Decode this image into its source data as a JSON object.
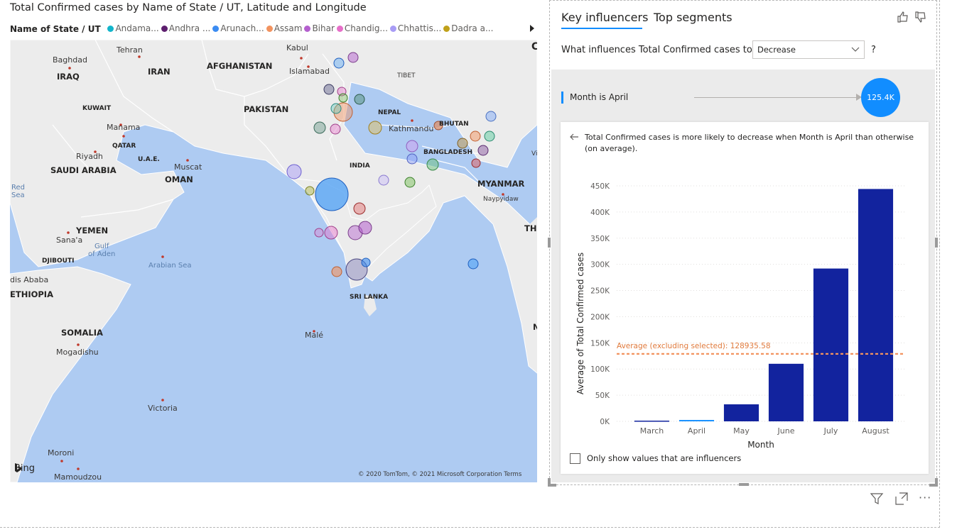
{
  "map_visual": {
    "title": "Total Confirmed cases by Name of State / UT, Latitude and Longitude",
    "legend": {
      "title": "Name of State / UT",
      "items": [
        {
          "label": "Andama...",
          "color": "#12b5cb"
        },
        {
          "label": "Andhra ...",
          "color": "#5d1e6e"
        },
        {
          "label": "Arunach...",
          "color": "#3b8cf2"
        },
        {
          "label": "Assam",
          "color": "#f2935f"
        },
        {
          "label": "Bihar",
          "color": "#b45fce"
        },
        {
          "label": "Chandig...",
          "color": "#e66fc8"
        },
        {
          "label": "Chhattis...",
          "color": "#a89cf5"
        },
        {
          "label": "Dadra a...",
          "color": "#c0a11a"
        }
      ],
      "next_icon": "chevron-right-icon"
    },
    "labels": {
      "baghdad": "Baghdad",
      "iraq": "IRAQ",
      "tehran": "Tehran",
      "iran": "IRAN",
      "kabul": "Kabul",
      "afghanistan": "AFGHANISTAN",
      "islamabad": "Islamabad",
      "tibet": "TIBET",
      "kuwait": "KUWAIT",
      "pakistan": "PAKISTAN",
      "manama": "Manama",
      "qatar": "QATAR",
      "riyadh": "Riyadh",
      "uae": "U.A.E.",
      "muscat": "Muscat",
      "saudi": "SAUDI ARABIA",
      "oman": "OMAN",
      "nepal": "NEPAL",
      "kathmandu": "Kathmandu",
      "bhutan": "BHUTAN",
      "bangladesh": "BANGLADESH",
      "india": "INDIA",
      "myanmar": "MYANMAR",
      "naypyidaw": "Naypyidaw",
      "red_sea": "Red\nSea",
      "yemen": "YEMEN",
      "sanaa": "Sana'a",
      "gulf_aden": "Gulf\nof Aden",
      "djibouti": "DJIBOUTI",
      "arabian_sea": "Arabian Sea",
      "addis": "dis Ababa",
      "ethiopia": "ETHIOPIA",
      "sri_lanka": "SRI LANKA",
      "somalia": "SOMALIA",
      "mogadishu": "Mogadishu",
      "male": "Malé",
      "victoria": "Victoria",
      "moroni": "Moroni",
      "mamoudzou": "Mamoudzou",
      "c_edge": "C",
      "th_edge": "TH",
      "vi_edge": "Vi",
      "n_edge": "N"
    },
    "bing_logo": "Bing",
    "attribution": "© 2020 TomTom, © 2021 Microsoft Corporation  Terms"
  },
  "key_influencers": {
    "tabs": [
      {
        "label": "Key influencers",
        "active": true
      },
      {
        "label": "Top segments",
        "active": false
      }
    ],
    "icons": {
      "thumb_up": "thumbs-up-icon",
      "thumb_down": "thumbs-down-icon"
    },
    "question": "What influences Total Confirmed cases to",
    "dropdown_value": "Decrease",
    "question_mark": "?",
    "influencer": {
      "label": "Month is April",
      "value": "125.4K"
    },
    "detail_text": "Total Confirmed cases is more likely to decrease when Month is April than otherwise (on average).",
    "checkbox_label": "Only show values that are influencers",
    "checkbox_checked": false,
    "toolbar_icons": [
      "filter-icon",
      "focus-mode-icon",
      "more-options-icon"
    ]
  },
  "chart_data": {
    "type": "bar",
    "categories": [
      "March",
      "April",
      "May",
      "June",
      "July",
      "August"
    ],
    "values": [
      1300,
      2600,
      32500,
      110000,
      292000,
      444000
    ],
    "highlighted_category": "April",
    "bar_color": "#12239e",
    "highlight_color": "#118dff",
    "xlabel": "Month",
    "ylabel": "Average of Total Confirmed cases",
    "ylim": [
      0,
      450000
    ],
    "yticks": [
      0,
      50000,
      100000,
      150000,
      200000,
      250000,
      300000,
      350000,
      400000,
      450000
    ],
    "ytick_labels": [
      "0K",
      "50K",
      "100K",
      "150K",
      "200K",
      "250K",
      "300K",
      "350K",
      "400K",
      "450K"
    ],
    "reference_line": {
      "value": 128935.58,
      "label": "Average (excluding selected): 128935.58",
      "color": "#f2935f"
    },
    "grid": true
  }
}
